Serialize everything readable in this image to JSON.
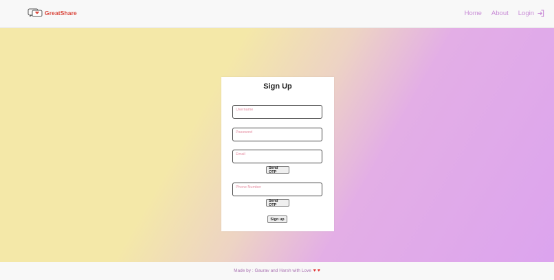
{
  "navbar": {
    "brand": "GreatShare",
    "links": [
      {
        "label": "Home"
      },
      {
        "label": "About"
      },
      {
        "label": "Login"
      }
    ]
  },
  "signup": {
    "title": "Sign Up",
    "fields": {
      "username": "Username",
      "password": "Password",
      "email": "Email",
      "phone": "Phone Number"
    },
    "send_otp_email": "Send OTP",
    "send_otp_phone": "Send OTP",
    "submit": "Sign up"
  },
  "footer": {
    "text": "Made by : Gaurav and Harsh with Love",
    "hearts": "♥ ♥"
  },
  "colors": {
    "accent": "#c88bd6",
    "brand": "#d9453a",
    "label": "#e58ca0"
  }
}
